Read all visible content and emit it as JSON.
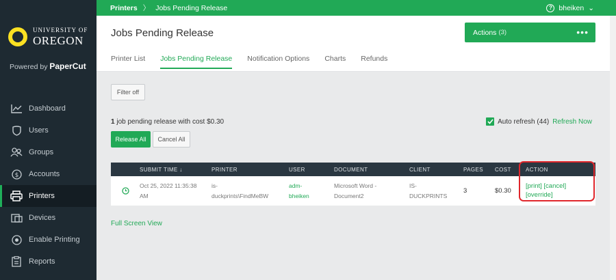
{
  "breadcrumb": {
    "root": "Printers",
    "separator": "〉",
    "current": "Jobs Pending Release"
  },
  "user": {
    "name": "bheiken",
    "help_glyph": "?",
    "chevron": "⌄"
  },
  "logo": {
    "line1": "UNIVERSITY OF",
    "line2": "OREGON",
    "powered_prefix": "Powered by",
    "powered_brand": "PaperCut"
  },
  "sidebar": {
    "items": [
      {
        "label": "Dashboard",
        "icon": "chart-line-icon"
      },
      {
        "label": "Users",
        "icon": "shield-icon"
      },
      {
        "label": "Groups",
        "icon": "users-icon"
      },
      {
        "label": "Accounts",
        "icon": "dollar-icon"
      },
      {
        "label": "Printers",
        "icon": "printer-icon",
        "active": true
      },
      {
        "label": "Devices",
        "icon": "device-icon"
      },
      {
        "label": "Enable Printing",
        "icon": "power-icon"
      },
      {
        "label": "Reports",
        "icon": "clipboard-icon"
      }
    ]
  },
  "header": {
    "title": "Jobs Pending Release",
    "actions_label": "Actions",
    "actions_count": "(3)",
    "actions_menu": "•••",
    "tabs": [
      "Printer List",
      "Jobs Pending Release",
      "Notification Options",
      "Charts",
      "Refunds"
    ],
    "active_tab": "Jobs Pending Release"
  },
  "content": {
    "filter_label": "Filter off",
    "summary_count": "1",
    "summary_text": " job pending release with cost $0.30",
    "release_all": "Release All",
    "cancel_all": "Cancel All",
    "auto_refresh_label": "Auto refresh (44)",
    "refresh_now": "Refresh Now",
    "full_screen": "Full Screen View"
  },
  "table": {
    "headers": {
      "time": "SUBMIT TIME ↓",
      "printer": "PRINTER",
      "user": "USER",
      "document": "DOCUMENT",
      "client": "CLIENT",
      "pages": "PAGES",
      "cost": "COST",
      "action": "ACTION"
    },
    "rows": [
      {
        "time_line1": "Oct 25, 2022 11:35:38",
        "time_line2": "AM",
        "printer_line1": "is-",
        "printer_line2": "duckprints\\FindMeBW",
        "user_line1": "adm-",
        "user_line2": "bheiken",
        "document_line1": "Microsoft Word -",
        "document_line2": "Document2",
        "client_line1": "IS-",
        "client_line2": "DUCKPRINTS",
        "pages": "3",
        "cost": "$0.30",
        "action_print": "[print]",
        "action_cancel": "[cancel]",
        "action_override": "[override]"
      }
    ]
  },
  "colors": {
    "accent": "#21a956",
    "sidebar": "#1e2a32",
    "table_header": "#2a3741",
    "highlight": "#e0262b"
  }
}
